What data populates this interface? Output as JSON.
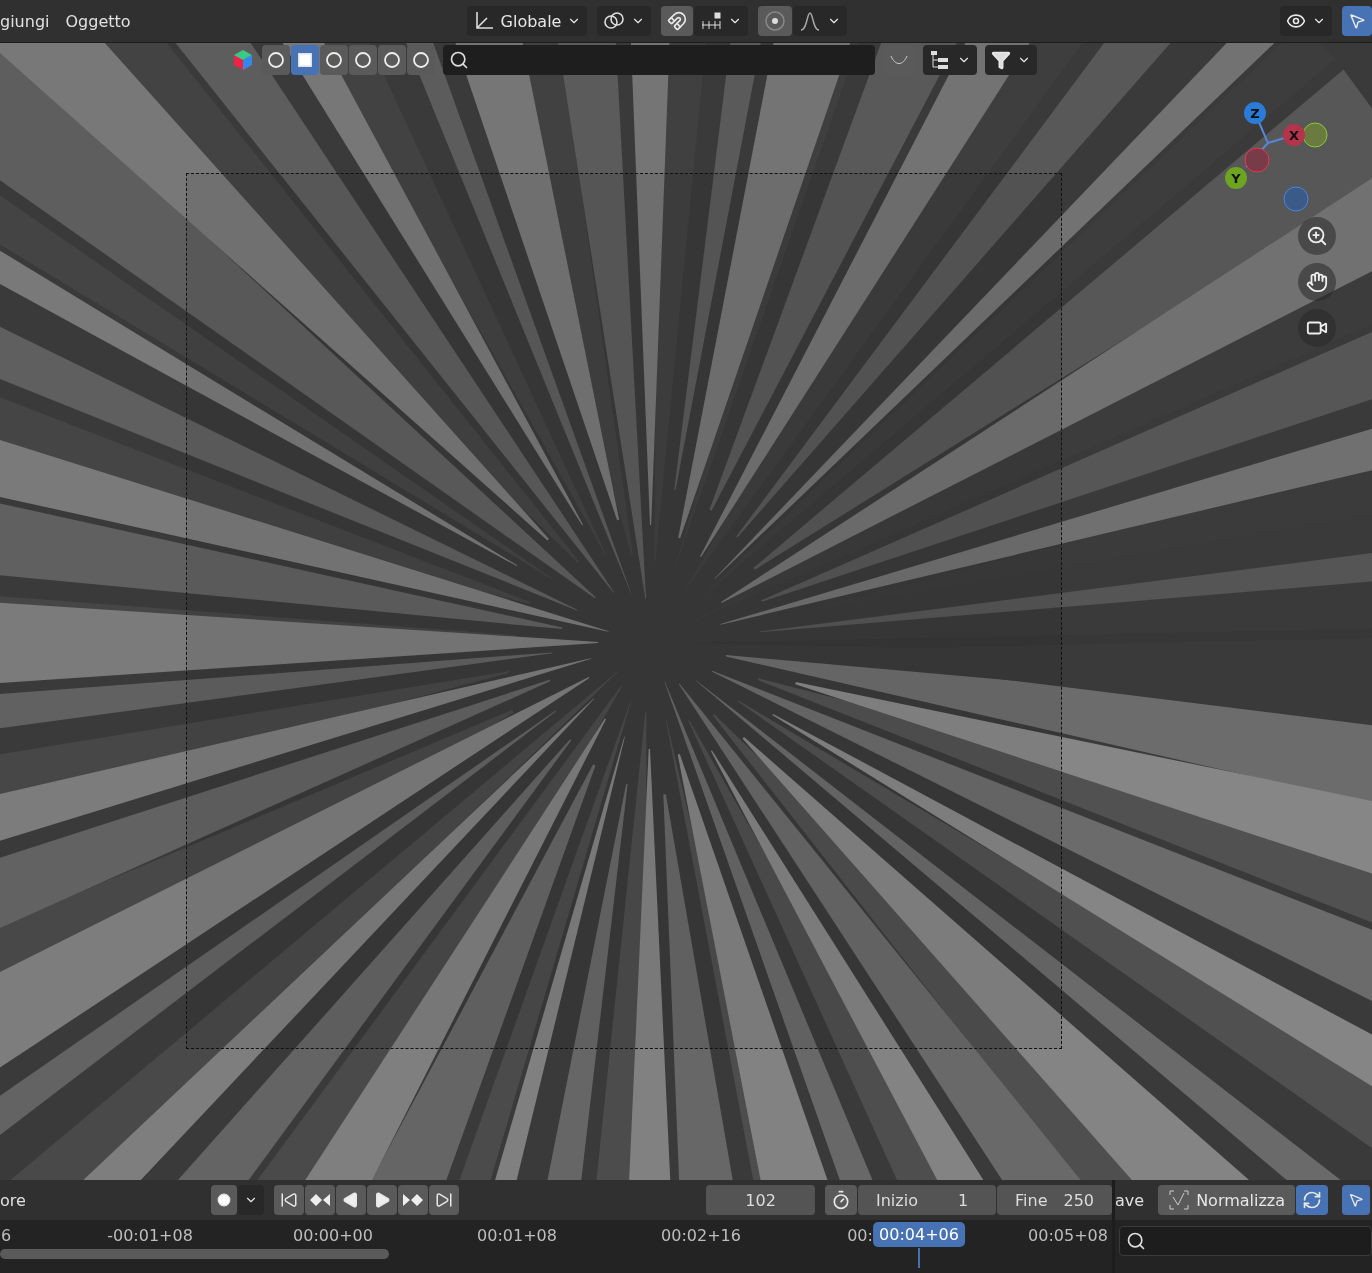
{
  "header": {
    "menus": [
      "giungi",
      "Oggetto"
    ],
    "orientation": "Globale",
    "snap_on": true,
    "proportional_on": true
  },
  "viewport_toolbar": {
    "filters": [
      {
        "selected": false
      },
      {
        "selected": true
      },
      {
        "selected": false
      },
      {
        "selected": false
      },
      {
        "selected": false
      },
      {
        "selected": false
      }
    ],
    "toggle_on": true
  },
  "gizmo": {
    "axes": [
      "Z",
      "X",
      "Y"
    ]
  },
  "timeline": {
    "menu_cut": "ore",
    "record_on": false,
    "frame": "102",
    "start_label": "Inizio",
    "start": "1",
    "end_label": "Fine",
    "end": "250",
    "ruler": [
      "6",
      "-00:01+08",
      "00:00+00",
      "00:01+08",
      "00:02+16",
      "00:",
      "00:05+08"
    ],
    "current": "00:04+06"
  },
  "graph_header": {
    "menu_cut": "ave",
    "normalize": "Normalizza",
    "normalize_on": false
  }
}
